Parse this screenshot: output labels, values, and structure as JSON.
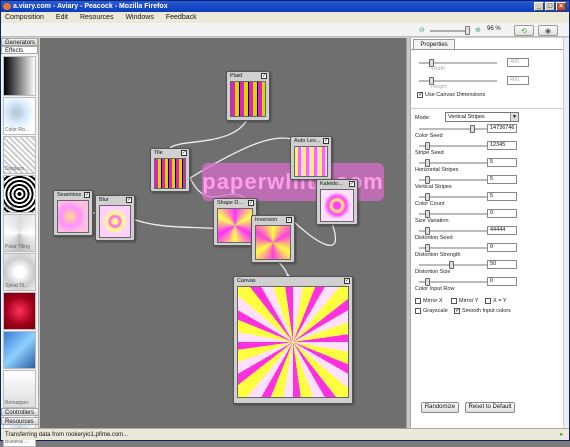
{
  "window": {
    "title": "Aviary - Peacock - Mozilla Firefox",
    "favicon": "firefox-icon"
  },
  "address": {
    "url": "a.viary.com"
  },
  "menu": [
    "Composition",
    "Edit",
    "Resources",
    "Windows",
    "Feedback"
  ],
  "toolbar": {
    "zoom_percent": "96 %",
    "zoom_fraction": 0.9
  },
  "left_panel": {
    "generators_label": "Generators",
    "effects_label": "Effects",
    "thumbs": [
      "Color Ro...",
      "Displace...",
      "Melt",
      "Polar Tiling",
      "Spiral Til...",
      "",
      "",
      "Remapper",
      "Bilateral ..."
    ],
    "controllers_label": "Controllers",
    "resources_label": "Resources"
  },
  "canvas": {
    "watermark": "paperwhite.com",
    "nodes": {
      "plaid": "Plaid",
      "tile": "Tile",
      "autolev": "Auto Lev...",
      "kaleido": "Kaleido...",
      "seamless": "Seamless",
      "blur": "Blur",
      "shaped": "Shape D...",
      "inversion": "Inversion",
      "canvas": "Canvas"
    }
  },
  "properties": {
    "tab": "Properties",
    "width_label": "Width",
    "width_value": "400",
    "height_label": "Height",
    "height_value": "400",
    "use_canvas_dims": "Use Canvas Dimensions",
    "mode_label": "Mode:",
    "mode_value": "Vertical Stripes",
    "params": [
      {
        "label": "Color Seed",
        "value": "14736746"
      },
      {
        "label": "Stripe Seed",
        "value": "12345"
      },
      {
        "label": "Horizontal Stripes",
        "value": "5"
      },
      {
        "label": "Vertical Stripes",
        "value": "5"
      },
      {
        "label": "Color Count",
        "value": "5"
      },
      {
        "label": "Size Variation",
        "value": "0"
      },
      {
        "label": "Distortion Seed",
        "value": "44444"
      },
      {
        "label": "Distortion Strength",
        "value": "0"
      },
      {
        "label": "Distortion Size",
        "value": "50"
      },
      {
        "label": "Color Input Row",
        "value": "0"
      }
    ],
    "checks": [
      "Mirror X",
      "Mirror Y",
      "X = Y",
      "Grayscale",
      "Smooth Input colors"
    ],
    "randomize": "Randomize",
    "reset": "Reset to Default"
  },
  "status": {
    "text": "Transferring data from rookeryio1.pfime.com..."
  }
}
